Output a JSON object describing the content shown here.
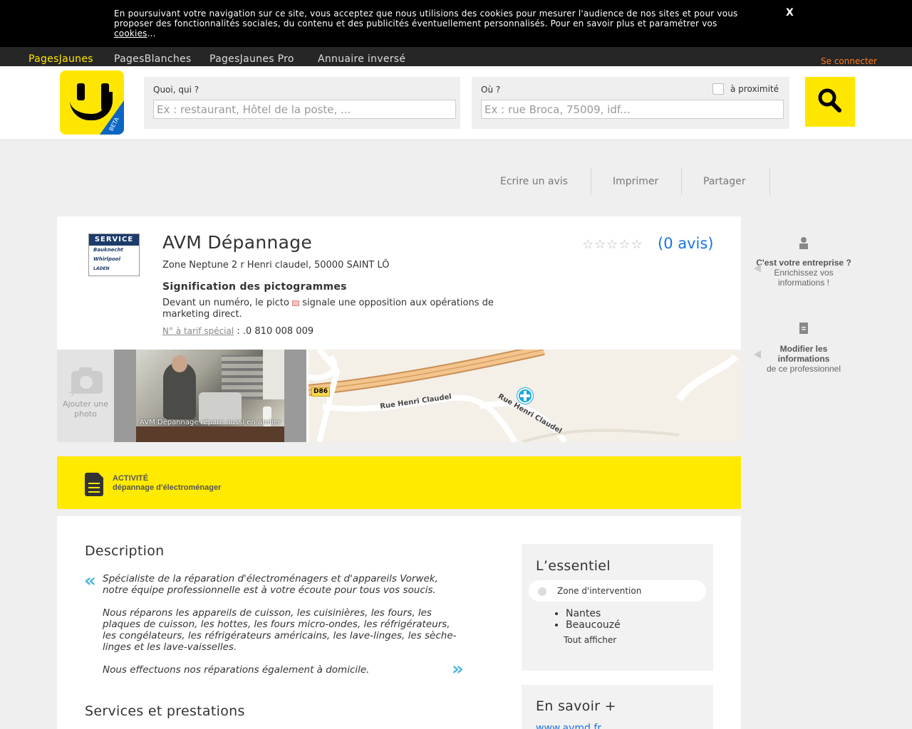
{
  "cookie": {
    "text": "En poursuivant votre navigation sur ce site, vous acceptez que nous utilisions des cookies pour mesurer l'audience de nos sites et pour vous proposer des fonctionnalités sociales, du contenu et des publicités éventuellement personnalisés. Pour en savoir plus et paramétrer vos",
    "link": "cookies",
    "ellipsis": "...",
    "close": "X"
  },
  "nav": {
    "items": [
      "PagesJaunes",
      "PagesBlanches",
      "PagesJaunes Pro",
      "Annuaire inversé"
    ],
    "login": "Se connecter"
  },
  "logo": {
    "badge": "BETA"
  },
  "search": {
    "what_label": "Quoi, qui ?",
    "what_placeholder": "Ex : restaurant, Hôtel de la poste, ...",
    "where_label": "Où ?",
    "where_placeholder": "Ex : rue Broca, 75009, idf...",
    "proximity": "à proximité"
  },
  "actions": [
    "Ecrire un avis",
    "Imprimer",
    "Partager"
  ],
  "business": {
    "name": "AVM Dépannage",
    "address": "Zone Neptune 2 r Henri claudel, 50000 SAINT LÔ",
    "reviews": "(0 avis)",
    "rating_stars": 0,
    "brand_logo": {
      "header": "SERVICE",
      "lines": [
        "Bauknecht",
        "Whirlpool",
        "LADEN"
      ]
    },
    "picto_title": "Signification des pictogrammes",
    "picto_before": "Devant un numéro, le picto",
    "picto_after": "signale une opposition aux opérations de marketing direct.",
    "tarif_link": "N° à tarif spécial",
    "tarif_sep": ":",
    "phone": ".0 810 008 009"
  },
  "media": {
    "add_photo": "Ajouter une photo",
    "photo_caption": "AVM Dépannage répare aussi en atelier",
    "map_road_badge": "D86",
    "map_labels": [
      "Rue Henri Claudel",
      "Rue Henri Claudel"
    ]
  },
  "activity": {
    "label": "ACTIVITÉ",
    "value": "dépannage d'électroménager"
  },
  "sidebar": {
    "owner": {
      "bold": "C'est votre entreprise ?",
      "normal": "Enrichissez vos informations !"
    },
    "modify": {
      "bold": "Modifier les informations",
      "normal": "de ce professionnel"
    }
  },
  "description": {
    "title": "Description",
    "p1": "Spécialiste de la réparation d'électroménagers et d'appareils Vorwek, notre équipe professionnelle est à votre écoute pour tous vos soucis.",
    "p2": "Nous réparons les appareils de cuisson, les cuisinières, les fours, les plaques de cuisson, les hottes, les fours micro-ondes, les réfrigérateurs, les congélateurs, les réfrigérateurs américains, les lave-linges, les sèche-linges et les lave-vaisselles.",
    "p3": "Nous effectuons nos réparations également à domicile."
  },
  "services_title": "Services et prestations",
  "essentiel": {
    "title": "L’essentiel",
    "zone": "Zone d'intervention",
    "cities": [
      "Nantes",
      "Beaucouzé"
    ],
    "show_all": "Tout afficher"
  },
  "savoir": {
    "title": "En savoir +",
    "link": "www.avmd.fr"
  }
}
